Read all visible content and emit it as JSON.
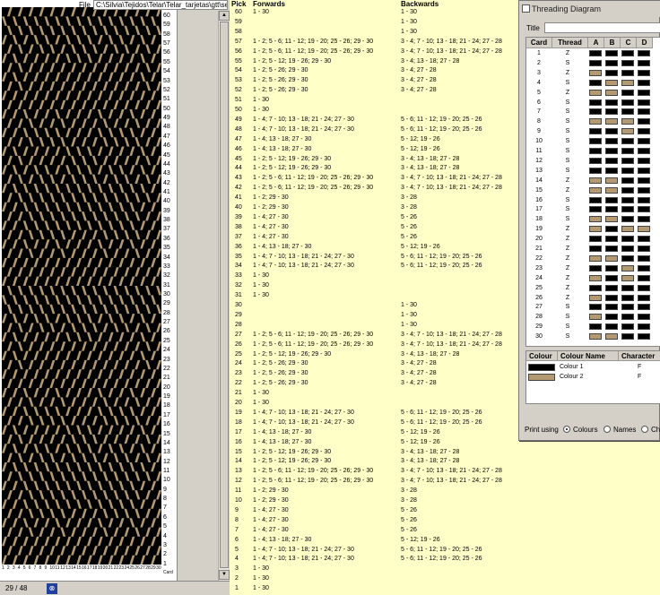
{
  "file": {
    "label": "File",
    "path": "C:\\Silvia\\Tejidos\\Telar\\Telar_tarjetas\\gtt\\sed"
  },
  "status": {
    "page": "29 / 48"
  },
  "weave": {
    "cols": 30,
    "picks": 60,
    "color1": "#000000",
    "color2": "#b49a73",
    "card_axis_label": "Card"
  },
  "list": {
    "header": {
      "pick": "Pick",
      "forwards": "Forwards",
      "backwards": "Backwards"
    },
    "rows": [
      {
        "p": "60",
        "f": "1 - 30",
        "b": "1 - 30"
      },
      {
        "p": "59",
        "f": "",
        "b": "1 - 30"
      },
      {
        "p": "58",
        "f": "",
        "b": "1 - 30"
      },
      {
        "p": "57",
        "f": "1 - 2; 5 - 6; 11 - 12; 19 - 20; 25 - 26; 29 - 30",
        "b": "3 - 4; 7 - 10; 13 - 18; 21 - 24; 27 - 28"
      },
      {
        "p": "56",
        "f": "1 - 2; 5 - 6; 11 - 12; 19 - 20; 25 - 26; 29 - 30",
        "b": "3 - 4; 7 - 10; 13 - 18; 21 - 24; 27 - 28"
      },
      {
        "p": "55",
        "f": "1 - 2; 5 - 12; 19 - 26; 29 - 30",
        "b": "3 - 4; 13 - 18; 27 - 28"
      },
      {
        "p": "54",
        "f": "1 - 2; 5 - 26; 29 - 30",
        "b": "3 - 4; 27 - 28"
      },
      {
        "p": "53",
        "f": "1 - 2; 5 - 26; 29 - 30",
        "b": "3 - 4; 27 - 28"
      },
      {
        "p": "52",
        "f": "1 - 2; 5 - 26; 29 - 30",
        "b": "3 - 4; 27 - 28"
      },
      {
        "p": "51",
        "f": "1 - 30",
        "b": ""
      },
      {
        "p": "50",
        "f": "1 - 30",
        "b": ""
      },
      {
        "p": "49",
        "f": "1 - 4; 7 - 10; 13 - 18; 21 - 24; 27 - 30",
        "b": "5 - 6; 11 - 12; 19 - 20; 25 - 26"
      },
      {
        "p": "48",
        "f": "1 - 4; 7 - 10; 13 - 18; 21 - 24; 27 - 30",
        "b": "5 - 6; 11 - 12; 19 - 20; 25 - 26"
      },
      {
        "p": "47",
        "f": "1 - 4; 13 - 18; 27 - 30",
        "b": "5 - 12; 19 - 26"
      },
      {
        "p": "46",
        "f": "1 - 4; 13 - 18; 27 - 30",
        "b": "5 - 12; 19 - 26"
      },
      {
        "p": "45",
        "f": "1 - 2; 5 - 12; 19 - 26; 29 - 30",
        "b": "3 - 4; 13 - 18; 27 - 28"
      },
      {
        "p": "44",
        "f": "1 - 2; 5 - 12; 19 - 26; 29 - 30",
        "b": "3 - 4; 13 - 18; 27 - 28"
      },
      {
        "p": "43",
        "f": "1 - 2; 5 - 6; 11 - 12; 19 - 20; 25 - 26; 29 - 30",
        "b": "3 - 4; 7 - 10; 13 - 18; 21 - 24; 27 - 28"
      },
      {
        "p": "42",
        "f": "1 - 2; 5 - 6; 11 - 12; 19 - 20; 25 - 26; 29 - 30",
        "b": "3 - 4; 7 - 10; 13 - 18; 21 - 24; 27 - 28"
      },
      {
        "p": "41",
        "f": "1 - 2; 29 - 30",
        "b": "3 - 28"
      },
      {
        "p": "40",
        "f": "1 - 2; 29 - 30",
        "b": "3 - 28"
      },
      {
        "p": "39",
        "f": "1 - 4; 27 - 30",
        "b": "5 - 26"
      },
      {
        "p": "38",
        "f": "1 - 4; 27 - 30",
        "b": "5 - 26"
      },
      {
        "p": "37",
        "f": "1 - 4; 27 - 30",
        "b": "5 - 26"
      },
      {
        "p": "36",
        "f": "1 - 4; 13 - 18; 27 - 30",
        "b": "5 - 12; 19 - 26"
      },
      {
        "p": "35",
        "f": "1 - 4; 7 - 10; 13 - 18; 21 - 24; 27 - 30",
        "b": "5 - 6; 11 - 12; 19 - 20; 25 - 26"
      },
      {
        "p": "34",
        "f": "1 - 4; 7 - 10; 13 - 18; 21 - 24; 27 - 30",
        "b": "5 - 6; 11 - 12; 19 - 20; 25 - 26"
      },
      {
        "p": "33",
        "f": "1 - 30",
        "b": ""
      },
      {
        "p": "32",
        "f": "1 - 30",
        "b": ""
      },
      {
        "p": "31",
        "f": "1 - 30",
        "b": ""
      },
      {
        "p": "30",
        "f": "",
        "b": "1 - 30"
      },
      {
        "p": "29",
        "f": "",
        "b": "1 - 30"
      },
      {
        "p": "28",
        "f": "",
        "b": "1 - 30"
      },
      {
        "p": "27",
        "f": "1 - 2; 5 - 6; 11 - 12; 19 - 20; 25 - 26; 29 - 30",
        "b": "3 - 4; 7 - 10; 13 - 18; 21 - 24; 27 - 28"
      },
      {
        "p": "26",
        "f": "1 - 2; 5 - 6; 11 - 12; 19 - 20; 25 - 26; 29 - 30",
        "b": "3 - 4; 7 - 10; 13 - 18; 21 - 24; 27 - 28"
      },
      {
        "p": "25",
        "f": "1 - 2; 5 - 12; 19 - 26; 29 - 30",
        "b": "3 - 4; 13 - 18; 27 - 28"
      },
      {
        "p": "24",
        "f": "1 - 2; 5 - 26; 29 - 30",
        "b": "3 - 4; 27 - 28"
      },
      {
        "p": "23",
        "f": "1 - 2; 5 - 26; 29 - 30",
        "b": "3 - 4; 27 - 28"
      },
      {
        "p": "22",
        "f": "1 - 2; 5 - 26; 29 - 30",
        "b": "3 - 4; 27 - 28"
      },
      {
        "p": "21",
        "f": "1 - 30",
        "b": ""
      },
      {
        "p": "20",
        "f": "1 - 30",
        "b": ""
      },
      {
        "p": "19",
        "f": "1 - 4; 7 - 10; 13 - 18; 21 - 24; 27 - 30",
        "b": "5 - 6; 11 - 12; 19 - 20; 25 - 26"
      },
      {
        "p": "18",
        "f": "1 - 4; 7 - 10; 13 - 18; 21 - 24; 27 - 30",
        "b": "5 - 6; 11 - 12; 19 - 20; 25 - 26"
      },
      {
        "p": "17",
        "f": "1 - 4; 13 - 18; 27 - 30",
        "b": "5 - 12; 19 - 26"
      },
      {
        "p": "16",
        "f": "1 - 4; 13 - 18; 27 - 30",
        "b": "5 - 12; 19 - 26"
      },
      {
        "p": "15",
        "f": "1 - 2; 5 - 12; 19 - 26; 29 - 30",
        "b": "3 - 4; 13 - 18; 27 - 28"
      },
      {
        "p": "14",
        "f": "1 - 2; 5 - 12; 19 - 26; 29 - 30",
        "b": "3 - 4; 13 - 18; 27 - 28"
      },
      {
        "p": "13",
        "f": "1 - 2; 5 - 6; 11 - 12; 19 - 20; 25 - 26; 29 - 30",
        "b": "3 - 4; 7 - 10; 13 - 18; 21 - 24; 27 - 28"
      },
      {
        "p": "12",
        "f": "1 - 2; 5 - 6; 11 - 12; 19 - 20; 25 - 26; 29 - 30",
        "b": "3 - 4; 7 - 10; 13 - 18; 21 - 24; 27 - 28"
      },
      {
        "p": "11",
        "f": "1 - 2; 29 - 30",
        "b": "3 - 28"
      },
      {
        "p": "10",
        "f": "1 - 2; 29 - 30",
        "b": "3 - 28"
      },
      {
        "p": "9",
        "f": "1 - 4; 27 - 30",
        "b": "5 - 26"
      },
      {
        "p": "8",
        "f": "1 - 4; 27 - 30",
        "b": "5 - 26"
      },
      {
        "p": "7",
        "f": "1 - 4; 27 - 30",
        "b": "5 - 26"
      },
      {
        "p": "6",
        "f": "1 - 4; 13 - 18; 27 - 30",
        "b": "5 - 12; 19 - 26"
      },
      {
        "p": "5",
        "f": "1 - 4; 7 - 10; 13 - 18; 21 - 24; 27 - 30",
        "b": "5 - 6; 11 - 12; 19 - 20; 25 - 26"
      },
      {
        "p": "4",
        "f": "1 - 4; 7 - 10; 13 - 18; 21 - 24; 27 - 30",
        "b": "5 - 6; 11 - 12; 19 - 20; 25 - 26"
      },
      {
        "p": "3",
        "f": "1 - 30",
        "b": ""
      },
      {
        "p": "2",
        "f": "1 - 30",
        "b": ""
      },
      {
        "p": "1",
        "f": "1 - 30",
        "b": ""
      }
    ]
  },
  "dialog": {
    "title": "Threading Diagram",
    "title_label": "Title",
    "title_value": "",
    "headers": {
      "card": "Card",
      "thread": "Thread",
      "a": "A",
      "b": "B",
      "c": "C",
      "d": "D"
    },
    "cards": [
      {
        "n": "1",
        "t": "Z",
        "h": [
          1,
          1,
          1,
          1
        ]
      },
      {
        "n": "2",
        "t": "S",
        "h": [
          1,
          1,
          1,
          1
        ]
      },
      {
        "n": "3",
        "t": "Z",
        "h": [
          2,
          1,
          1,
          1
        ]
      },
      {
        "n": "4",
        "t": "S",
        "h": [
          1,
          2,
          2,
          1
        ]
      },
      {
        "n": "5",
        "t": "Z",
        "h": [
          2,
          2,
          1,
          1
        ]
      },
      {
        "n": "6",
        "t": "S",
        "h": [
          1,
          1,
          1,
          1
        ]
      },
      {
        "n": "7",
        "t": "S",
        "h": [
          1,
          1,
          1,
          1
        ]
      },
      {
        "n": "8",
        "t": "S",
        "h": [
          2,
          2,
          2,
          1
        ]
      },
      {
        "n": "9",
        "t": "S",
        "h": [
          1,
          1,
          2,
          1
        ]
      },
      {
        "n": "10",
        "t": "S",
        "h": [
          1,
          1,
          1,
          1
        ]
      },
      {
        "n": "11",
        "t": "S",
        "h": [
          1,
          1,
          1,
          1
        ]
      },
      {
        "n": "12",
        "t": "S",
        "h": [
          1,
          1,
          1,
          1
        ]
      },
      {
        "n": "13",
        "t": "S",
        "h": [
          1,
          1,
          1,
          1
        ]
      },
      {
        "n": "14",
        "t": "Z",
        "h": [
          2,
          2,
          1,
          1
        ]
      },
      {
        "n": "15",
        "t": "Z",
        "h": [
          2,
          2,
          1,
          1
        ]
      },
      {
        "n": "16",
        "t": "S",
        "h": [
          1,
          1,
          1,
          1
        ]
      },
      {
        "n": "17",
        "t": "S",
        "h": [
          1,
          1,
          1,
          1
        ]
      },
      {
        "n": "18",
        "t": "S",
        "h": [
          2,
          2,
          1,
          1
        ]
      },
      {
        "n": "19",
        "t": "Z",
        "h": [
          2,
          1,
          2,
          2
        ]
      },
      {
        "n": "20",
        "t": "Z",
        "h": [
          1,
          1,
          1,
          1
        ]
      },
      {
        "n": "21",
        "t": "Z",
        "h": [
          1,
          1,
          1,
          1
        ]
      },
      {
        "n": "22",
        "t": "Z",
        "h": [
          2,
          2,
          1,
          1
        ]
      },
      {
        "n": "23",
        "t": "Z",
        "h": [
          1,
          1,
          2,
          1
        ]
      },
      {
        "n": "24",
        "t": "Z",
        "h": [
          2,
          1,
          2,
          1
        ]
      },
      {
        "n": "25",
        "t": "Z",
        "h": [
          1,
          1,
          1,
          1
        ]
      },
      {
        "n": "26",
        "t": "Z",
        "h": [
          2,
          1,
          1,
          1
        ]
      },
      {
        "n": "27",
        "t": "S",
        "h": [
          1,
          1,
          1,
          1
        ]
      },
      {
        "n": "28",
        "t": "S",
        "h": [
          2,
          1,
          1,
          1
        ]
      },
      {
        "n": "29",
        "t": "S",
        "h": [
          1,
          1,
          1,
          1
        ]
      },
      {
        "n": "30",
        "t": "S",
        "h": [
          2,
          2,
          1,
          1
        ]
      }
    ],
    "colour_headers": {
      "colour": "Colour",
      "name": "Colour Name",
      "character": "Character"
    },
    "colours": [
      {
        "hex": "#000000",
        "name": "Colour 1",
        "char": "F"
      },
      {
        "hex": "#b49a73",
        "name": "Colour 2",
        "char": "F"
      }
    ],
    "print_using": {
      "label": "Print using",
      "opt1": "Colours",
      "opt2": "Names",
      "opt3": "Cha"
    }
  }
}
